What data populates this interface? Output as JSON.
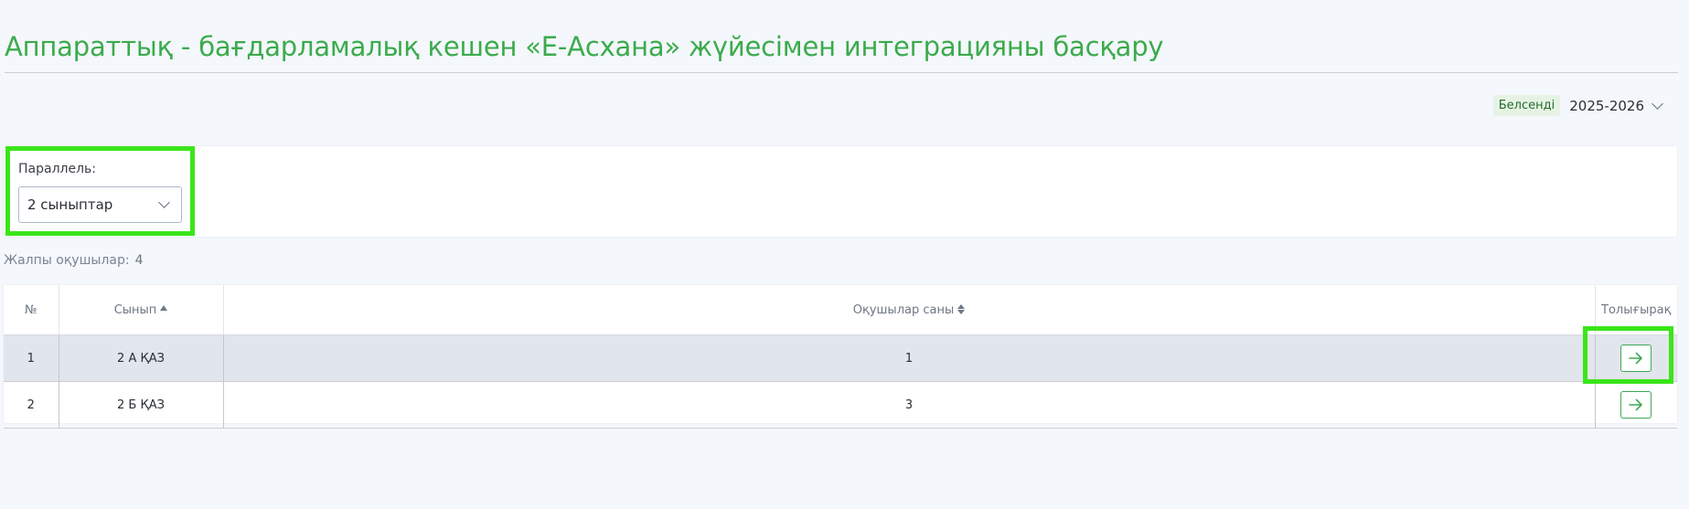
{
  "page": {
    "title": "Аппараттық - бағдарламалық кешен «Е-Асхана» жүйесімен интеграцияны басқару"
  },
  "year_selector": {
    "status_badge": "Белсенді",
    "value": "2025-2026"
  },
  "filter": {
    "label": "Параллель:",
    "selected": "2 сыныптар"
  },
  "summary": {
    "total_label": "Жалпы оқушылар:",
    "total_value": "4"
  },
  "table": {
    "columns": {
      "number": "№",
      "class": "Сынып",
      "students": "Оқушылар саны",
      "details": "Толығырақ"
    },
    "rows": [
      {
        "number": "1",
        "class": "2 А ҚАЗ",
        "students": "1"
      },
      {
        "number": "2",
        "class": "2 Б ҚАЗ",
        "students": "3"
      }
    ]
  },
  "colors": {
    "accent_green": "#3bab4c",
    "highlight_green": "#3be51a",
    "selected_row": "#e1e5ec"
  },
  "icons": {
    "dropdown": "chevron-down-icon",
    "open_row": "arrow-right-icon",
    "sort": "sort-icon"
  }
}
